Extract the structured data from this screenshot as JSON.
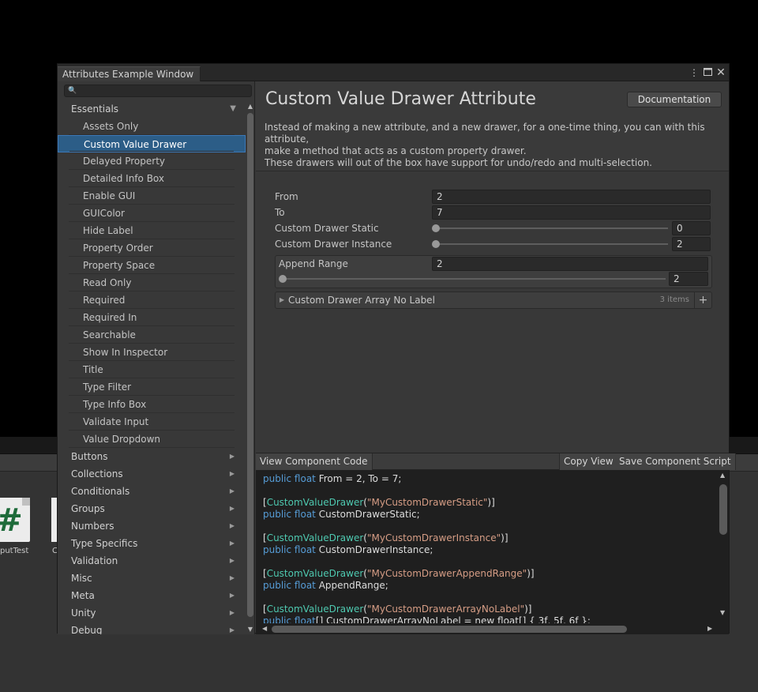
{
  "window": {
    "title": "Attributes Example Window",
    "menu_icon": "kebab-menu-icon",
    "maximize_icon": "maximize-icon",
    "close_icon": "close-icon"
  },
  "search": {
    "placeholder": ""
  },
  "menu": {
    "categories_top": [
      {
        "label": "Essentials",
        "expanded": true
      }
    ],
    "essentials": [
      "Assets Only",
      "Custom Value Drawer",
      "Delayed Property",
      "Detailed Info Box",
      "Enable GUI",
      "GUIColor",
      "Hide Label",
      "Property Order",
      "Property Space",
      "Read Only",
      "Required",
      "Required In",
      "Searchable",
      "Show In Inspector",
      "Title",
      "Type Filter",
      "Type Info Box",
      "Validate Input",
      "Value Dropdown"
    ],
    "selected": "Custom Value Drawer",
    "categories": [
      "Buttons",
      "Collections",
      "Conditionals",
      "Groups",
      "Numbers",
      "Type Specifics",
      "Validation",
      "Misc",
      "Meta",
      "Unity",
      "Debug"
    ]
  },
  "header": {
    "title": "Custom Value Drawer Attribute",
    "doc_button": "Documentation",
    "desc1": "Instead of making a new attribute, and a new drawer, for a one-time thing, you can with this attribute,",
    "desc2": "make a method that acts as a custom property drawer.",
    "desc3": "These drawers will out of the box have support for undo/redo and multi-selection."
  },
  "inspector": {
    "from_label": "From",
    "from_value": "2",
    "to_label": "To",
    "to_value": "7",
    "static_label": "Custom Drawer Static",
    "static_value": "0",
    "static_fraction": 0.0,
    "instance_label": "Custom Drawer Instance",
    "instance_value": "2",
    "instance_fraction": 0.0,
    "append_label": "Append Range",
    "append_value": "2",
    "append_slider_value": "2",
    "append_fraction": 0.0,
    "array_label": "Custom Drawer Array No Label",
    "array_count": "3 items",
    "add_symbol": "+"
  },
  "code_toolbar": {
    "view_code": "View Component Code",
    "copy_view": "Copy View",
    "save_script": "Save Component Script"
  },
  "code": {
    "l1_kw": "public float",
    "l1_rest": " From = 2, To = 7;",
    "l3_open": "[",
    "l3_type": "CustomValueDrawer",
    "l3_paren": "(",
    "l3_str": "\"MyCustomDrawerStatic\"",
    "l3_close": ")]",
    "l4_kw": "public float",
    "l4_rest": " CustomDrawerStatic;",
    "l6_open": "[",
    "l6_type": "CustomValueDrawer",
    "l6_paren": "(",
    "l6_str": "\"MyCustomDrawerInstance\"",
    "l6_close": ")]",
    "l7_kw": "public float",
    "l7_rest": " CustomDrawerInstance;",
    "l9_open": "[",
    "l9_type": "CustomValueDrawer",
    "l9_paren": "(",
    "l9_str": "\"MyCustomDrawerAppendRange\"",
    "l9_close": ")]",
    "l10_kw": "public float",
    "l10_rest": " AppendRange;",
    "l12_open": "[",
    "l12_type": "CustomValueDrawer",
    "l12_paren": "(",
    "l12_str": "\"MyCustomDrawerArrayNoLabel\"",
    "l12_close": ")]",
    "l13_kw": "public float",
    "l13_rest": "[] CustomDrawerArrayNoLabel = new float[] { 3f, 5f, 6f };"
  },
  "background": {
    "asset1_label": "putTest",
    "asset2_label": "C",
    "asset1_glyph": "#"
  }
}
